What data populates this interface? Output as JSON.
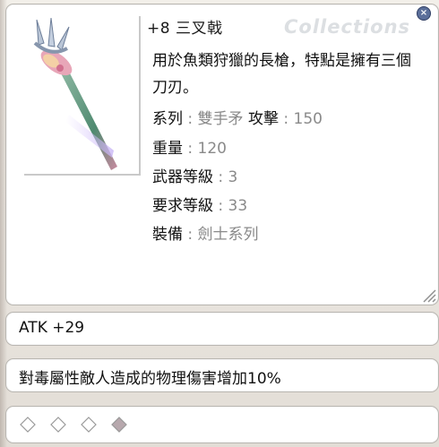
{
  "item": {
    "title": "+8 三叉戟",
    "watermark": "Collections",
    "description": "用於魚類狩獵的長槍，特點是擁有三個刀刃。",
    "properties": [
      {
        "label": "系列",
        "sep": " : ",
        "value": "雙手矛"
      },
      {
        "label": "重量",
        "sep": " : ",
        "value": "120"
      },
      {
        "label": "武器等級",
        "sep": " : ",
        "value": "3"
      },
      {
        "label": "要求等級",
        "sep": " : ",
        "value": "33"
      },
      {
        "label": "裝備",
        "sep": " : ",
        "value": "劍士系列"
      }
    ],
    "attack": {
      "label": "攻擊",
      "sep": " : ",
      "value": "150"
    }
  },
  "bonuses": {
    "atk": "ATK +29",
    "effect": "對毒屬性敵人造成的物理傷害增加10%"
  },
  "cards": {
    "slots": [
      "empty",
      "empty",
      "empty",
      "filled"
    ],
    "colors": {
      "empty": "#ffffff",
      "filled": "#b7a8ad",
      "border": "#9a9a9a"
    }
  },
  "icons": {
    "close": "close-icon",
    "resize": "resize-grip-icon",
    "item": "trident-icon"
  }
}
